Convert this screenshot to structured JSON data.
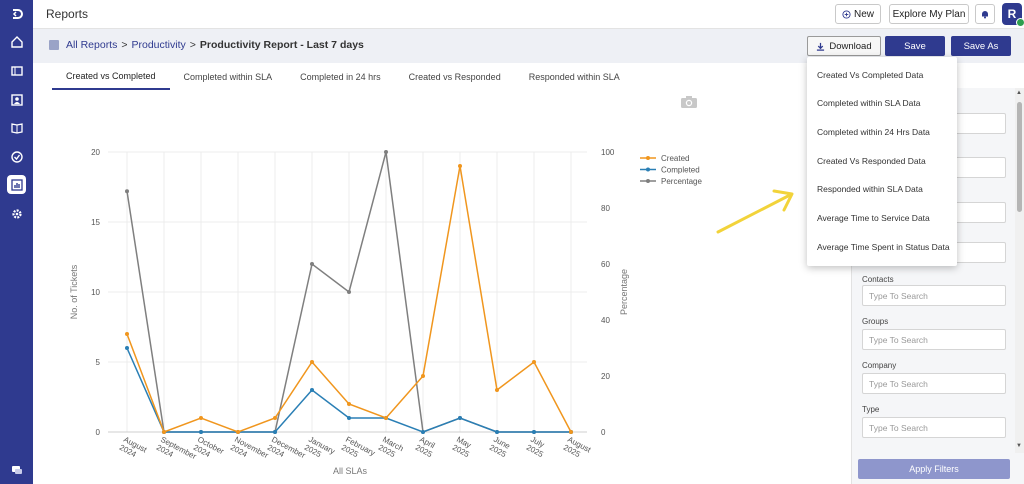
{
  "app": {
    "title": "Reports"
  },
  "topbar": {
    "new_label": "New",
    "explore_label": "Explore My Plan",
    "avatar_initial": "R"
  },
  "breadcrumb": {
    "root": "All Reports",
    "section": "Productivity",
    "current": "Productivity Report - Last 7 days",
    "separator": ">"
  },
  "actions": {
    "download_label": "Download",
    "save_label": "Save",
    "save_as_label": "Save As"
  },
  "tabs": [
    {
      "label": "Created vs Completed",
      "active": true
    },
    {
      "label": "Completed within SLA",
      "active": false
    },
    {
      "label": "Completed in 24 hrs",
      "active": false
    },
    {
      "label": "Created vs Responded",
      "active": false
    },
    {
      "label": "Responded within SLA",
      "active": false
    }
  ],
  "download_menu": [
    "Created Vs Completed Data",
    "Completed within SLA Data",
    "Completed within 24 Hrs Data",
    "Created Vs Responded Data",
    "Responded within SLA Data",
    "Average Time to Service Data",
    "Average Time Spent in Status Data"
  ],
  "filters": {
    "fields": [
      {
        "label": "Contacts",
        "placeholder": "Type To Search"
      },
      {
        "label": "Groups",
        "placeholder": "Type To Search"
      },
      {
        "label": "Company",
        "placeholder": "Type To Search"
      },
      {
        "label": "Type",
        "placeholder": "Type To Search"
      }
    ],
    "apply_label": "Apply Filters"
  },
  "colors": {
    "brand": "#2f3a8f",
    "created": "#f0961e",
    "completed": "#2a7fb5",
    "percentage": "#7f7f7f",
    "arrow": "#f2d33a"
  },
  "chart_data": {
    "type": "line",
    "xlabel": "All SLAs",
    "ylabel": "No. of Tickets",
    "y2label": "Percentage",
    "ylim": [
      0,
      20
    ],
    "y2lim": [
      0,
      100
    ],
    "yticks": [
      0,
      5,
      10,
      15,
      20
    ],
    "y2ticks": [
      0,
      20,
      40,
      60,
      80,
      100
    ],
    "grid": true,
    "legend_position": "top-right",
    "categories": [
      [
        "August",
        "2024"
      ],
      [
        "September",
        "2024"
      ],
      [
        "October",
        "2024"
      ],
      [
        "November",
        "2024"
      ],
      [
        "December",
        "2024"
      ],
      [
        "January",
        "2025"
      ],
      [
        "February",
        "2025"
      ],
      [
        "March",
        "2025"
      ],
      [
        "April",
        "2025"
      ],
      [
        "May",
        "2025"
      ],
      [
        "June",
        "2025"
      ],
      [
        "July",
        "2025"
      ],
      [
        "August",
        "2025"
      ]
    ],
    "series": [
      {
        "name": "Created",
        "axis": "left",
        "values": [
          7,
          0,
          1,
          0,
          1,
          5,
          2,
          1,
          4,
          19,
          3,
          5,
          0
        ]
      },
      {
        "name": "Completed",
        "axis": "left",
        "values": [
          6,
          0,
          0,
          0,
          0,
          3,
          1,
          1,
          0,
          1,
          0,
          0,
          0
        ]
      },
      {
        "name": "Percentage",
        "axis": "right",
        "values": [
          86,
          0,
          0,
          0,
          0,
          60,
          50,
          100,
          0,
          5,
          0,
          0,
          0
        ]
      }
    ]
  }
}
